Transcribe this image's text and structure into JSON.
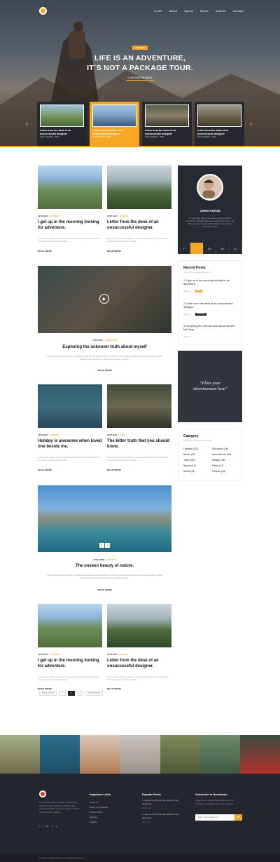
{
  "nav": [
    "Home",
    "About",
    "Sports",
    "Movie",
    "Internet",
    "Contact"
  ],
  "hero": {
    "badge": "TRAVEL",
    "title_line1": "LIFE IS AN ADVENTURE,",
    "title_line2": "IT`S NOT A PACKAGE TOUR.",
    "cta": "CONTINUE READING",
    "slides": [
      {
        "title": "Letter from the desk of an unsuccessful designer",
        "meta": "21ST JANUARY , 2016"
      },
      {
        "title": "Letter from the desk of an unsuccessful designer",
        "meta": "21ST JANUARY , 2016"
      },
      {
        "title": "Letter from the desk of an unsuccessful designer",
        "meta": "21ST JANUARY , 2016"
      },
      {
        "title": "Letter from the desk of an unsuccessful designer",
        "meta": "21ST JANUARY , 2016"
      }
    ]
  },
  "posts": {
    "p1": {
      "date": "12TH MAY",
      "cat": "TRAVEL",
      "title": "I get up in the morning looking for adventure.",
      "excerpt": "Lorem ipsum dolor sit amet, consectetuer adipiscing elit, sed Nam consetety ditit-esumod tincidunt.",
      "read": "READ MORE"
    },
    "p2": {
      "date": "21ST MAY",
      "cat": "TRAVEL",
      "title": "Letter from the desk of an unsuccessful designer.",
      "excerpt": "Lorem ipsum dolor sit amet, consectetuer adipiscing elit, sed Nam consetety ditit-esumod tincidunt.",
      "read": "READ MORE"
    },
    "p3": {
      "date": "13TH MAY",
      "cat": "LIFESTYLE",
      "title": "Exploring the unknown truth about myself",
      "excerpt": "Lorem ipsum dolor sit amet, consectetuer adipiscing elit, sed diam nonummy nibh euismod tincidunt ut laoreet dolore magna aliquam erat volutpat. Ut wisi enim ad minim veniam.",
      "read": "READ MORE"
    },
    "p4": {
      "date": "12TH MAY",
      "cat": "TRAVEL",
      "title": "Holiday is awesome when loved one beside me.",
      "excerpt": "Lorem ipsum dolor sit amet, consectetuer adipiscing elit, sed Nam consetety ditit-esumod tincidunt.",
      "read": "READ MORE"
    },
    "p5": {
      "date": "21ST MAY",
      "cat": "LIFE",
      "title": "The bitter truth that you should know.",
      "excerpt": "Lorem ipsum dolor sit amet, consectetuer adipiscing elit, sed Nam consetety ditit-esumod tincidunt.",
      "read": "READ MORE"
    },
    "p6": {
      "date": "12TH APRIL",
      "cat": "WORLD",
      "title": "The unseen beauty of nature.",
      "excerpt": "Lorem ipsum dolor sit amet, consectetuer adipiscing elit, sed diam nonummy nibh euismod tincidunt ut laoreet dolore magna aliquam erat volutpat. Ut wisi enim ad minim veniam.",
      "read": "READ MORE"
    },
    "p7": {
      "date": "12TH MAY",
      "cat": "TRAVEL",
      "title": "I get up in the morning looking for adventure.",
      "excerpt": "Lorem ipsum dolor sit amet, consectetuer adipiscing elit, sed Nam consetety ditit-esumod tincidunt.",
      "read": "READ MORE"
    },
    "p8": {
      "date": "21ST MAY",
      "cat": "TRAVEL",
      "title": "Letter from the desk of an unsuccessful designer.",
      "excerpt": "Lorem ipsum dolor sit amet, consectetuer adipiscing elit, sed Nam consetety ditit-esumod tincidunt.",
      "read": "READ MORE"
    }
  },
  "profile": {
    "name": "JOHN ASTON",
    "desc": "Hi, I am John Aston. Duis autem vel eum iriure in hendrerit in vulputate velit esse molestie consequat, vel illum dolore eu feugiat nulla facilisis at vero eros et accumsan et iusto."
  },
  "recent": {
    "heading": "Recent Posts",
    "sub": "your most recent post written in the",
    "items": [
      {
        "title": "1. I get up in the morning looking for an adventure.",
        "date": "2016 Jan",
        "tag": "NEW"
      },
      {
        "title": "2. Letter from the desk of an unsuccessful designer.",
        "date": "2016 Jan",
        "tag": "TRENDING"
      },
      {
        "title": "3. Exploring the unknow truth about myself – My Story.",
        "date": "2016 Jan",
        "tag": ""
      }
    ]
  },
  "ad": {
    "line1": "“Place your",
    "line2": "Advertisement here”"
  },
  "category": {
    "heading": "Category",
    "sub": "Browse all your favourite categories",
    "items": [
      "Lifestyle (23)",
      "Education (18)",
      "Movie (32)",
      "International (09)",
      "Travel (11)",
      "Design (28)",
      "Sports (18)",
      "News (17)",
      "Music (01)",
      "Review (18)"
    ]
  },
  "pager": {
    "prev": "PREV POST",
    "pages": [
      "1",
      "2",
      "3"
    ],
    "current": "2",
    "next": "NEXT POST"
  },
  "footer": {
    "about": "Lorem ipsum dolor sit amet, consectetuer adipiscing elit, sed Nam consetety ditit-euismod tincidunt ut laoreet dolore. Ut wisi enim ad minim veniam.",
    "links_h": "Important Links",
    "links": [
      "About us",
      "Terms & Conditions",
      "Privacy Policy",
      "Sitemap",
      "Support"
    ],
    "popular_h": "Popular Posts",
    "popular": [
      {
        "title": "1. I get up in the morning looking for an adventure.",
        "date": "2016 Jan"
      },
      {
        "title": "2. I get up in the morning looking for an adventure.",
        "date": "2016 Jan"
      }
    ],
    "news_h": "Subscribe to Newsletter",
    "news_text": "Lorem ipsum dolor sit amet iriure dolor in hendrerit in vulputate velit esse molestie.",
    "news_placeholder": "Enter your email here",
    "copyright": "© 2016 Copyright 2016, Ltd. All Rights Reserved"
  }
}
